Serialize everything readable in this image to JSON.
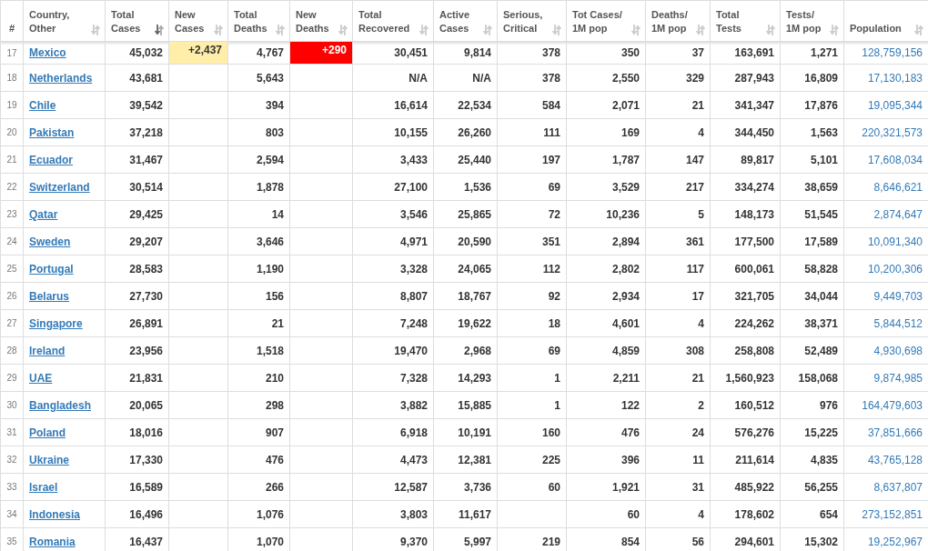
{
  "table": {
    "columns": [
      {
        "label": "#",
        "kind": "index"
      },
      {
        "label": "Country,\nOther",
        "kind": "country",
        "sorted": false
      },
      {
        "label": "Total\nCases",
        "kind": "number",
        "sorted": true
      },
      {
        "label": "New\nCases",
        "kind": "new_cases",
        "sorted": false
      },
      {
        "label": "Total\nDeaths",
        "kind": "number",
        "sorted": false
      },
      {
        "label": "New\nDeaths",
        "kind": "new_deaths",
        "sorted": false
      },
      {
        "label": "Total\nRecovered",
        "kind": "number",
        "sorted": false
      },
      {
        "label": "Active\nCases",
        "kind": "number",
        "sorted": false
      },
      {
        "label": "Serious,\nCritical",
        "kind": "number",
        "sorted": false
      },
      {
        "label": "Tot Cases/\n1M pop",
        "kind": "number",
        "sorted": false
      },
      {
        "label": "Deaths/\n1M pop",
        "kind": "number",
        "sorted": false
      },
      {
        "label": "Total\nTests",
        "kind": "number",
        "sorted": false
      },
      {
        "label": "Tests/\n1M pop",
        "kind": "number",
        "sorted": false
      },
      {
        "label": "Population",
        "kind": "population",
        "sorted": false
      }
    ],
    "rows": [
      {
        "cells": [
          "17",
          "Mexico",
          "45,032",
          "+2,437",
          "4,767",
          "+290",
          "30,451",
          "9,814",
          "378",
          "350",
          "37",
          "163,691",
          "1,271",
          "128,759,156"
        ]
      },
      {
        "cells": [
          "18",
          "Netherlands",
          "43,681",
          null,
          "5,643",
          null,
          "N/A",
          "N/A",
          "378",
          "2,550",
          "329",
          "287,943",
          "16,809",
          "17,130,183"
        ]
      },
      {
        "cells": [
          "19",
          "Chile",
          "39,542",
          null,
          "394",
          null,
          "16,614",
          "22,534",
          "584",
          "2,071",
          "21",
          "341,347",
          "17,876",
          "19,095,344"
        ]
      },
      {
        "cells": [
          "20",
          "Pakistan",
          "37,218",
          null,
          "803",
          null,
          "10,155",
          "26,260",
          "111",
          "169",
          "4",
          "344,450",
          "1,563",
          "220,321,573"
        ]
      },
      {
        "cells": [
          "21",
          "Ecuador",
          "31,467",
          null,
          "2,594",
          null,
          "3,433",
          "25,440",
          "197",
          "1,787",
          "147",
          "89,817",
          "5,101",
          "17,608,034"
        ]
      },
      {
        "cells": [
          "22",
          "Switzerland",
          "30,514",
          null,
          "1,878",
          null,
          "27,100",
          "1,536",
          "69",
          "3,529",
          "217",
          "334,274",
          "38,659",
          "8,646,621"
        ]
      },
      {
        "cells": [
          "23",
          "Qatar",
          "29,425",
          null,
          "14",
          null,
          "3,546",
          "25,865",
          "72",
          "10,236",
          "5",
          "148,173",
          "51,545",
          "2,874,647"
        ]
      },
      {
        "cells": [
          "24",
          "Sweden",
          "29,207",
          null,
          "3,646",
          null,
          "4,971",
          "20,590",
          "351",
          "2,894",
          "361",
          "177,500",
          "17,589",
          "10,091,340"
        ]
      },
      {
        "cells": [
          "25",
          "Portugal",
          "28,583",
          null,
          "1,190",
          null,
          "3,328",
          "24,065",
          "112",
          "2,802",
          "117",
          "600,061",
          "58,828",
          "10,200,306"
        ]
      },
      {
        "cells": [
          "26",
          "Belarus",
          "27,730",
          null,
          "156",
          null,
          "8,807",
          "18,767",
          "92",
          "2,934",
          "17",
          "321,705",
          "34,044",
          "9,449,703"
        ]
      },
      {
        "cells": [
          "27",
          "Singapore",
          "26,891",
          null,
          "21",
          null,
          "7,248",
          "19,622",
          "18",
          "4,601",
          "4",
          "224,262",
          "38,371",
          "5,844,512"
        ]
      },
      {
        "cells": [
          "28",
          "Ireland",
          "23,956",
          null,
          "1,518",
          null,
          "19,470",
          "2,968",
          "69",
          "4,859",
          "308",
          "258,808",
          "52,489",
          "4,930,698"
        ]
      },
      {
        "cells": [
          "29",
          "UAE",
          "21,831",
          null,
          "210",
          null,
          "7,328",
          "14,293",
          "1",
          "2,211",
          "21",
          "1,560,923",
          "158,068",
          "9,874,985"
        ]
      },
      {
        "cells": [
          "30",
          "Bangladesh",
          "20,065",
          null,
          "298",
          null,
          "3,882",
          "15,885",
          "1",
          "122",
          "2",
          "160,512",
          "976",
          "164,479,603"
        ]
      },
      {
        "cells": [
          "31",
          "Poland",
          "18,016",
          null,
          "907",
          null,
          "6,918",
          "10,191",
          "160",
          "476",
          "24",
          "576,276",
          "15,225",
          "37,851,666"
        ]
      },
      {
        "cells": [
          "32",
          "Ukraine",
          "17,330",
          null,
          "476",
          null,
          "4,473",
          "12,381",
          "225",
          "396",
          "11",
          "211,614",
          "4,835",
          "43,765,128"
        ]
      },
      {
        "cells": [
          "33",
          "Israel",
          "16,589",
          null,
          "266",
          null,
          "12,587",
          "3,736",
          "60",
          "1,921",
          "31",
          "485,922",
          "56,255",
          "8,637,807"
        ]
      },
      {
        "cells": [
          "34",
          "Indonesia",
          "16,496",
          null,
          "1,076",
          null,
          "3,803",
          "11,617",
          null,
          "60",
          "4",
          "178,602",
          "654",
          "273,152,851"
        ]
      },
      {
        "cells": [
          "35",
          "Romania",
          "16,437",
          null,
          "1,070",
          null,
          "9,370",
          "5,997",
          "219",
          "854",
          "56",
          "294,601",
          "15,302",
          "19,252,967"
        ]
      }
    ]
  }
}
